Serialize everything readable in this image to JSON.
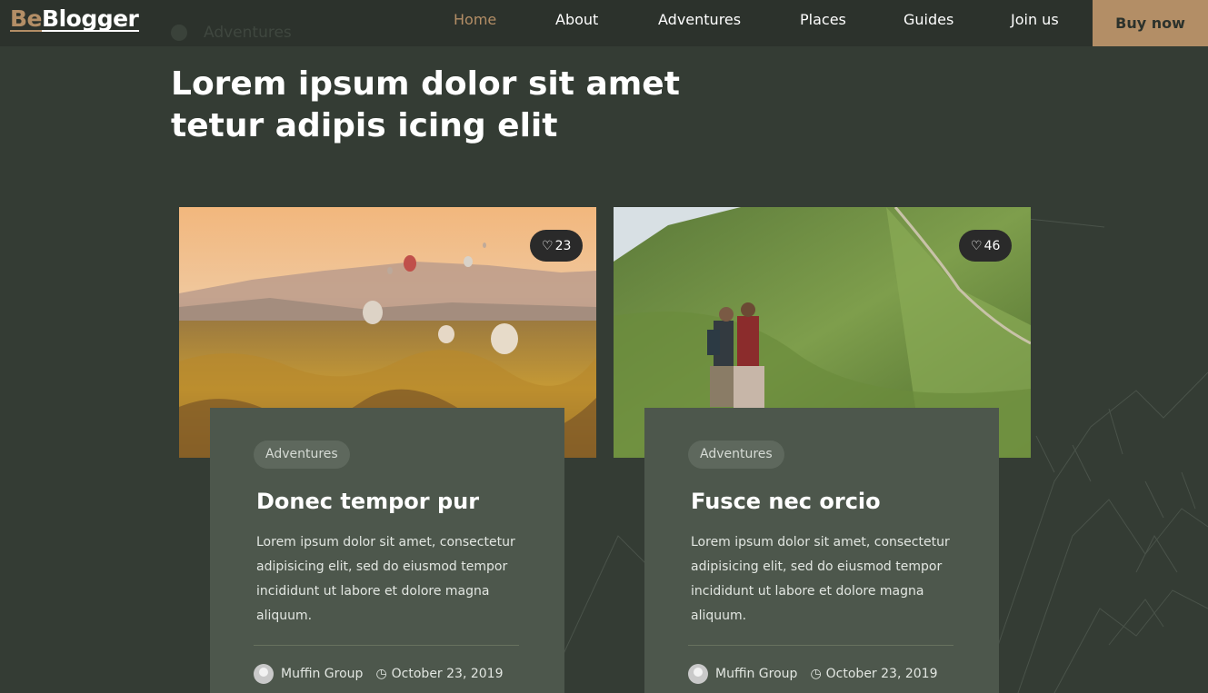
{
  "header": {
    "logo_prefix": "Be",
    "logo_suffix": "Blogger",
    "ghost_crumb": "Adventures",
    "nav": [
      {
        "label": "Home",
        "active": true
      },
      {
        "label": "About"
      },
      {
        "label": "Adventures"
      },
      {
        "label": "Places"
      },
      {
        "label": "Guides"
      },
      {
        "label": "Join us"
      }
    ],
    "cta": "Buy now"
  },
  "hero": {
    "title_line1": "Lorem ipsum dolor sit amet",
    "title_line2": "tetur adipis icing elit"
  },
  "posts": [
    {
      "likes": "23",
      "image": "hot-air-balloons-landscape",
      "category": "Adventures",
      "title": "Donec tempor pur",
      "excerpt": "Lorem ipsum dolor sit amet, consectetur adipisicing elit, sed do eiusmod tempor incididunt ut labore et dolore magna aliquum.",
      "author": "Muffin Group",
      "date": "October 23, 2019"
    },
    {
      "likes": "46",
      "image": "hikers-green-hills",
      "category": "Adventures",
      "title": "Fusce nec orcio",
      "excerpt": "Lorem ipsum dolor sit amet, consectetur adipisicing elit, sed do eiusmod tempor incididunt ut labore et dolore magna aliquum.",
      "author": "Muffin Group",
      "date": "October 23, 2019"
    }
  ],
  "colors": {
    "background": "#343c34",
    "header": "#2c322c",
    "accent": "#b38e66",
    "card": "#4d574c"
  }
}
